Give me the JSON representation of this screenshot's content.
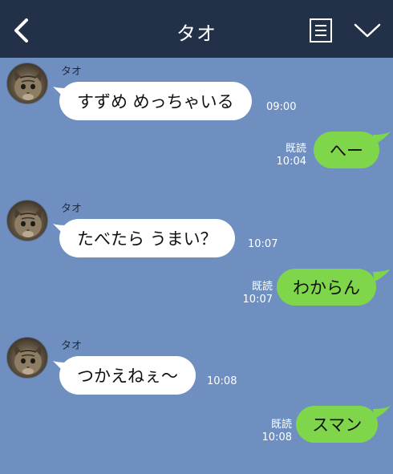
{
  "header": {
    "title": "タオ",
    "back_icon": "chevron-left-icon",
    "note_icon": "note-icon",
    "menu_icon": "chevron-down-icon",
    "bg_color": "#233148"
  },
  "colors": {
    "chat_bg": "#6e8fc0",
    "incoming_bubble": "#ffffff",
    "outgoing_bubble": "#7fd64b"
  },
  "messages": [
    {
      "direction": "in",
      "sender": "タオ",
      "text": "すずめ めっちゃいる",
      "time": "09:00"
    },
    {
      "direction": "out",
      "text": "へー",
      "read": "既読",
      "time": "10:04"
    },
    {
      "direction": "in",
      "sender": "タオ",
      "text": "たべたら うまい？",
      "time": "10:07"
    },
    {
      "direction": "out",
      "text": "わからん",
      "read": "既読",
      "time": "10:07"
    },
    {
      "direction": "in",
      "sender": "タオ",
      "text": "つかえねぇ〜",
      "time": "10:08"
    },
    {
      "direction": "out",
      "text": "スマン",
      "read": "既読",
      "time": "10:08"
    }
  ]
}
